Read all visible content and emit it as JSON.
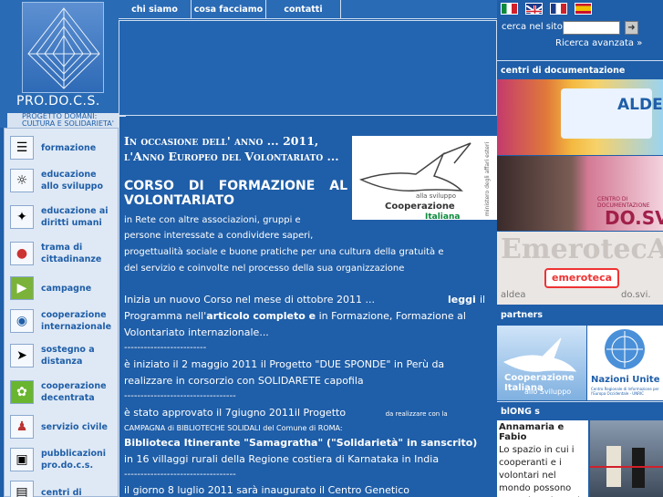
{
  "logo": {
    "title": "PRO.DO.C.S.",
    "subtitle_1": "PROGETTO DOMANI:",
    "subtitle_2": "CULTURA E SOLIDARIETA'"
  },
  "topmenu": [
    "chi siamo",
    "cosa facciamo",
    "contatti"
  ],
  "leftnav": [
    {
      "label": "formazione",
      "icon": "books-icon"
    },
    {
      "label": "educazione allo sviluppo",
      "icon": "globe-icon"
    },
    {
      "label": "educazione ai diritti umani",
      "icon": "human-figure-icon"
    },
    {
      "label": "trama di cittadinanze",
      "icon": "sphere-icon"
    },
    {
      "label": "campagne",
      "icon": "megaphone-icon"
    },
    {
      "label": "cooperazione internazionale",
      "icon": "earth-icon"
    },
    {
      "label": "sostegno a distanza",
      "icon": "running-figure-icon"
    },
    {
      "label": "cooperazione decentrata",
      "icon": "flower-icon"
    },
    {
      "label": "servizio civile",
      "icon": "people-icon"
    },
    {
      "label": "pubblicazioni pro.do.c.s.",
      "icon": "publication-icon"
    },
    {
      "label": "centri di",
      "icon": "documents-icon"
    }
  ],
  "search": {
    "label": "cerca nel sito:",
    "value": "",
    "button_icon": "arrow-right-icon",
    "advanced": "Ricerca avanzata »"
  },
  "languages": [
    "it-flag-icon",
    "en-flag-icon",
    "fr-flag-icon",
    "es-flag-icon"
  ],
  "right": {
    "doc_centers": "centri di documentazione",
    "aldea": "ALDEA",
    "dosvi_small": "CENTRO DI DOCUMENTAZIONE",
    "dosvi": "DO.SVI.",
    "emeroteca_big": "EmerotecA",
    "emeroteca": "emeroteca",
    "aldea_small": "aldea",
    "dosvi_small2": "do.svi.",
    "partners": "partners",
    "coop_label": "Cooperazione Italiana",
    "coop_sub": "allo Sviluppo",
    "un_label": "Nazioni Unite",
    "un_sub": "Centro Regionale di Informazione per l'Europa Occidentale - UNRIC",
    "blongs": "blONG s",
    "blong_name": "Annamaria e Fabio",
    "blong_text": "Lo spazio in cui i cooperanti e i volontari nel mondo possono tenerci aggiornati sulla loro attività."
  },
  "coop_logo": {
    "top": "alla sviluppo",
    "name_a": "Cooperazione",
    "name_b": "Italiana",
    "side": "ministero degli affari esteri"
  },
  "main": {
    "headline": "In occasione dell' anno ... 2011, l'Anno Europeo del Volontariato ...",
    "course_title": "CORSO DI FORMAZIONE AL VOLONTARIATO",
    "p1a": "in Rete con altre associazioni, gruppi e",
    "p1b": "persone interessate a condividere saperi,",
    "p1c": "progettualità sociale e buone pratiche per una cultura della gratuità e",
    "p1d": "del servizio e coinvolte nel processo della sua organizzazione",
    "p2a": "Inizia un nuovo Corso nel mese di ottobre 2011 ...",
    "p2_link": "leggi",
    "p2_il": "il",
    "p2b": "Programma nell'",
    "p2b_bold": "articolo completo e",
    "p2b_rest": "in Formazione, Formazione al",
    "p2c": "Volontariato internazionale...",
    "sep1": "-------------------------",
    "p3a": "è iniziato il 2 maggio 2011 il Progetto \"DUE SPONDE\" in Perù da",
    "p3b": "realizzare in corsorzio con SOLIDARETE capofila",
    "sep2": "----------------------------------",
    "p4a": "è stato approvato il 7giugno 2011il Progetto",
    "p4a_small": "da realizzare con la",
    "p4b": "CAMPAGNA di BIBLIOTECHE SOLIDALI del Comune di ROMA:",
    "p4c": "Biblioteca Itinerante \"Samagratha\" (\"Solidarietà\" in sanscrito)",
    "p4d": "in 16 villaggi rurali della Regione costiera di Karnataka in India",
    "sep3": "----------------------------------",
    "p5": "il giorno 8 luglio 2011 sarà inaugurato il Centro Genetico"
  },
  "colors": {
    "page": "#1f5ea8",
    "nav_bg": "#dfe9f5",
    "nav_text": "#1f5ea8",
    "header": "#2a6bb5"
  }
}
